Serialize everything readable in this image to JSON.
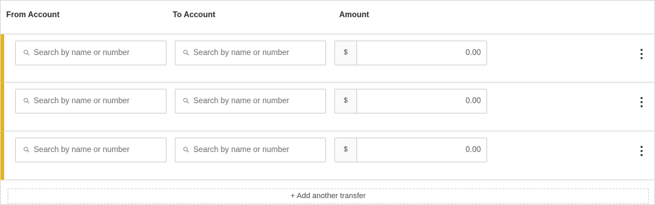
{
  "header": {
    "from_label": "From Account",
    "to_label": "To Account",
    "amount_label": "Amount"
  },
  "rows": [
    {
      "from_placeholder": "Search by name or number",
      "to_placeholder": "Search by name or number",
      "currency": "$",
      "amount": "0.00"
    },
    {
      "from_placeholder": "Search by name or number",
      "to_placeholder": "Search by name or number",
      "currency": "$",
      "amount": "0.00"
    },
    {
      "from_placeholder": "Search by name or number",
      "to_placeholder": "Search by name or number",
      "currency": "$",
      "amount": "0.00"
    }
  ],
  "add_transfer_label": "+ Add another transfer",
  "colors": {
    "accent": "#e5b21a",
    "border": "#d5d5d5"
  },
  "icons": {
    "search": "search-icon",
    "more": "more-vertical-icon"
  }
}
